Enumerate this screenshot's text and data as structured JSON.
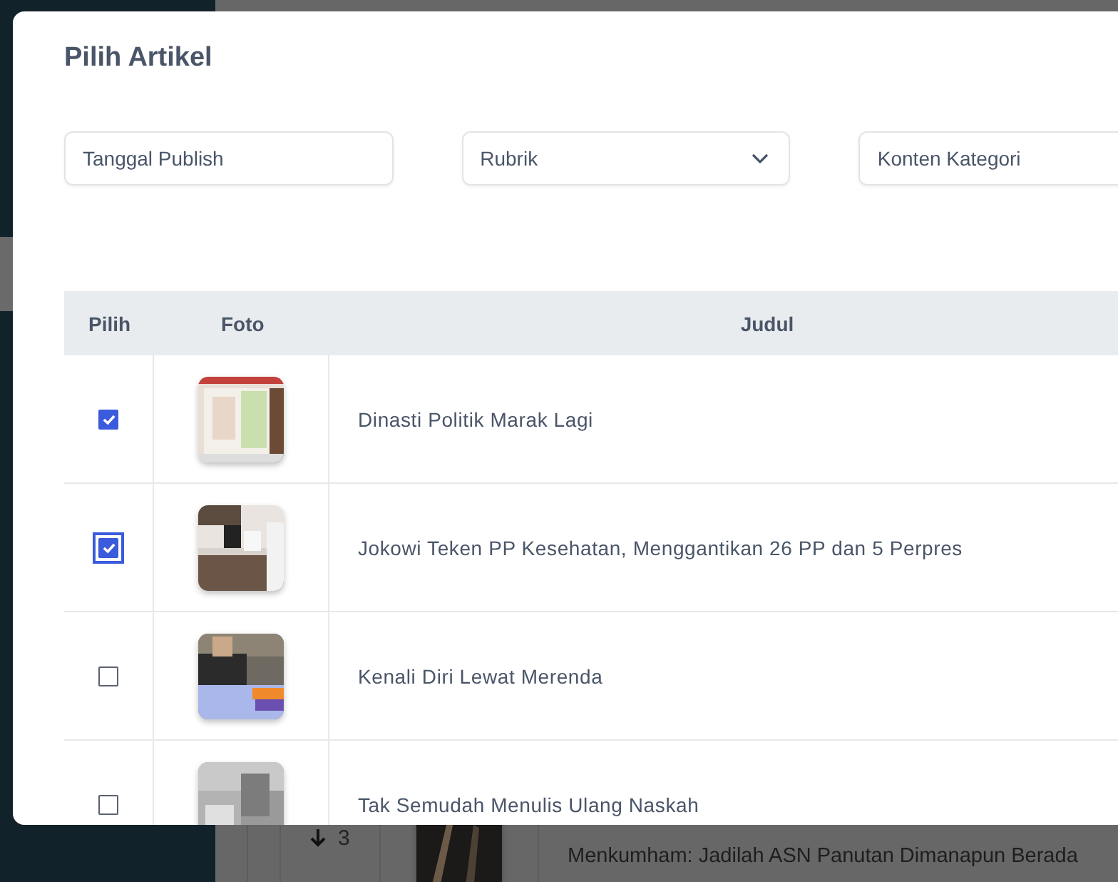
{
  "modal": {
    "title": "Pilih Artikel",
    "filters": [
      {
        "kind": "text",
        "placeholder": "Tanggal Publish"
      },
      {
        "kind": "select",
        "value": "Rubrik"
      },
      {
        "kind": "text",
        "placeholder": "Konten Kategori"
      }
    ],
    "table": {
      "columns": [
        "Pilih",
        "Foto",
        "Judul"
      ],
      "rows": [
        {
          "checked": true,
          "focused": false,
          "title": "Dinasti Politik Marak Lagi"
        },
        {
          "checked": true,
          "focused": true,
          "title": "Jokowi Teken PP Kesehatan, Menggantikan 26 PP dan 5 Perpres"
        },
        {
          "checked": false,
          "focused": false,
          "title": "Kenali Diri Lewat Merenda"
        },
        {
          "checked": false,
          "focused": false,
          "title": "Tak Semudah Menulis Ulang Naskah"
        }
      ]
    }
  },
  "background_row": {
    "order": "3",
    "title": "Menkumham: Jadilah ASN Panutan Dimanapun Berada"
  }
}
